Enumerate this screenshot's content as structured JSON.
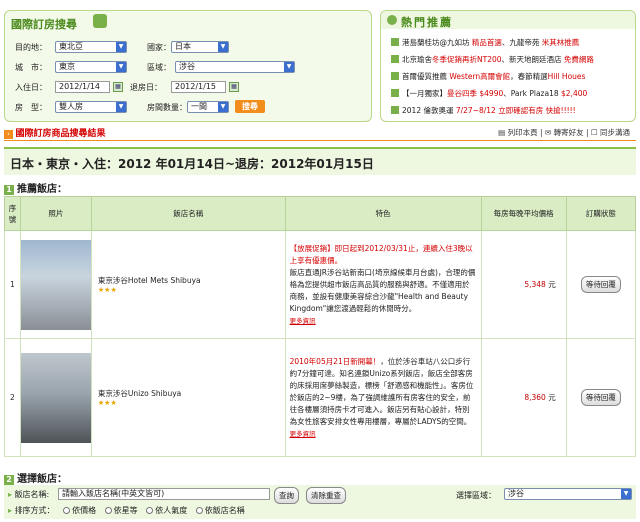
{
  "search_panel": {
    "title": "國際訂房搜尋",
    "destination_label": "目的地：",
    "destination_value": "東北亞",
    "country_label": "國家：",
    "country_value": "日本",
    "city_label": "城　市：",
    "city_value": "東京",
    "area_label": "區域：",
    "area_value": "涉谷",
    "checkin_label": "入住日：",
    "checkin_value": "2012/1/14",
    "checkout_label": "退房日：",
    "checkout_value": "2012/1/15",
    "room_type_label": "房　型：",
    "room_type_value": "雙人房",
    "room_count_label": "房間數量：",
    "room_count_value": "一間",
    "search_button": "搜尋"
  },
  "hot_panel": {
    "title": "熱門推薦",
    "items": [
      {
        "a": "港島蘭桂坊@九如坊 ",
        "b": "精品首選",
        "c": "、九龍帝苑 ",
        "d": "米其林推薦"
      },
      {
        "a": "北京瑜舍",
        "b": "冬季促銷再折NT200",
        "c": "、新天地朗廷酒店 ",
        "d": "免費網路"
      },
      {
        "a": "首爾優質推薦 ",
        "b": "Western高爾會館",
        "c": "，春節精選",
        "d": "Hill Houes"
      },
      {
        "a": "【一月獨家】",
        "b": "曼谷四季 $4990",
        "c": "、Park Plaza18 ",
        "d": "$2,400"
      },
      {
        "a": "2012 倫敦奧運 ",
        "b": "7/27~8/12 立即確認有房 快搶!!!!!",
        "c": "",
        "d": ""
      }
    ]
  },
  "results": {
    "header": "國際訂房商品搜尋結果",
    "tool_print": "列印本頁",
    "tool_share": "轉寄好友",
    "tool_sync": "同步溝通",
    "date_line": "日本・東京・入住：2012 年01月14日~退房：2012年01月15日",
    "section1": "推薦飯店：",
    "section1_num": "1",
    "section2": "選擇飯店：",
    "section2_num": "2"
  },
  "table": {
    "headers": [
      "序號",
      "照片",
      "飯店名稱",
      "特色",
      "每房每晚平均價格",
      "訂購狀態"
    ],
    "rows": [
      {
        "no": "1",
        "name": "東京涉谷Hotel Mets Shibuya",
        "stars": "★★★",
        "promo": "【放展促銷】即日起到2012/03/31止，連續入住3晚以上享有優惠價。",
        "desc": "飯店直通JR涉谷站新南口(埼京線候車月台處)，合理的價格為您提供超市飯店高品質的服務與舒適。不僅適用於商務，並設有健康美容綜合沙龍\"Health and Beauty Kingdom\"讓您渡過輕鬆的休閒時分。",
        "more": "更多資訊",
        "price": "5,348",
        "currency": "元",
        "status": "等待回覆"
      },
      {
        "no": "2",
        "name": "東京涉谷Unizo Shibuya",
        "stars": "★★★",
        "promo": "2010年05月21日新開幕！",
        "desc": "，位於涉谷車站八公口步行約7分鐘可達。知名連鎖Unizo系列飯店，飯店全部客房的床採用席夢絲製造，標榜「舒適感和機能性」。客房位於飯店的2~9樓，為了強調維護所有房客住的安全，前往各樓層須持房卡才可進入。飯店另有貼心設計，特別為女性旅客安排女性專用樓層，專屬於LADYS的空間。",
        "more": "更多資訊",
        "price": "8,360",
        "currency": "元",
        "status": "等待回覆"
      }
    ]
  },
  "filter": {
    "name_label": "飯店名稱:",
    "name_placeholder": "請輸入飯店名稱(中英文皆可)",
    "search_btn": "查詢",
    "reset_btn": "清除重查",
    "area_label": "選擇區域：",
    "area_value": "涉谷",
    "sort_label": "排序方式：",
    "sort_options": [
      "依價格",
      "依星等",
      "依人氣度",
      "依飯店名稱"
    ]
  }
}
